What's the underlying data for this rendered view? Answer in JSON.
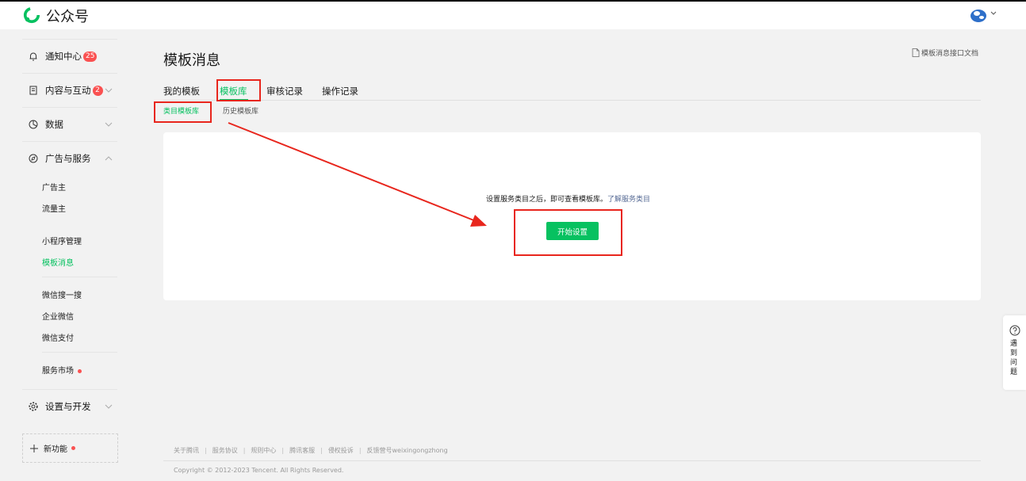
{
  "header": {
    "brand": "公众号",
    "brand_color": "#07c160"
  },
  "sidebar": {
    "notification": {
      "label": "通知中心",
      "badge": "25",
      "icon": "bell-icon"
    },
    "content": {
      "label": "内容与互动",
      "badge": "2",
      "icon": "document-icon"
    },
    "data": {
      "label": "数据",
      "icon": "pie-chart-icon"
    },
    "ads": {
      "label": "广告与服务",
      "icon": "compass-icon",
      "items": [
        "广告主",
        "流量主",
        "小程序管理",
        "模板消息",
        "微信搜一搜",
        "企业微信",
        "微信支付",
        "服务市场"
      ],
      "active": "模板消息"
    },
    "settings": {
      "label": "设置与开发",
      "icon": "gear-icon"
    },
    "new_features": {
      "label": "新功能"
    }
  },
  "main": {
    "title": "模板消息",
    "doc_link": "模板消息接口文档",
    "tabs": [
      "我的模板",
      "模板库",
      "审核记录",
      "操作记录"
    ],
    "active_tab": "模板库",
    "subtabs": [
      "类目模板库",
      "历史模板库"
    ],
    "active_subtab": "类目模板库",
    "hint": "设置服务类目之后，即可查看模板库。",
    "hint_link": "了解服务类目",
    "start_button": "开始设置"
  },
  "footer": {
    "links": [
      "关于腾讯",
      "服务协议",
      "规则中心",
      "腾讯客服",
      "侵权投诉",
      "反馈营号weixingongzhong"
    ],
    "copyright": "Copyright © 2012-2023 Tencent. All Rights Reserved."
  },
  "help": {
    "label": "遇到问题"
  },
  "annotation_color": "#e8261d"
}
